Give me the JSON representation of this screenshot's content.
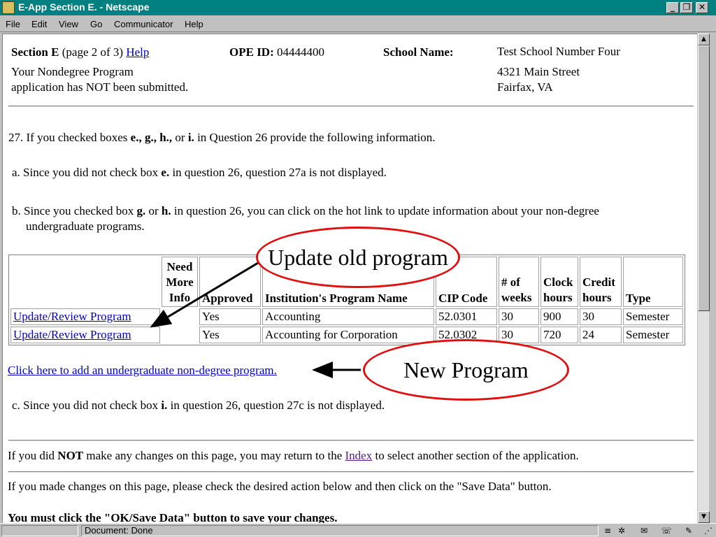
{
  "window": {
    "title": "E-App Section E. - Netscape"
  },
  "menu": [
    "File",
    "Edit",
    "View",
    "Go",
    "Communicator",
    "Help"
  ],
  "header": {
    "section_label": "Section E",
    "page_info": "(page 2 of 3)",
    "help_link": "Help",
    "ope_label": "OPE ID:",
    "ope_value": "04444400",
    "school_label": "School Name:",
    "school_name": "Test School Number Four",
    "address_line1": "4321 Main Street",
    "address_line2": "Fairfax, VA",
    "status_line1": "Your Nondegree Program",
    "status_line2": "application has NOT been submitted."
  },
  "q27": {
    "intro_pre": "27. If you checked boxes ",
    "intro_bold": "e., g., h.,",
    "intro_mid": " or ",
    "intro_bold2": "i.",
    "intro_post": " in Question 26 provide the following information.",
    "a_pre": "a. Since you did not check box ",
    "a_bold": "e.",
    "a_post": " in question 26, question 27a is not displayed.",
    "b_pre": "b. Since you checked box ",
    "b_bold1": "g.",
    "b_mid": " or ",
    "b_bold2": "h.",
    "b_post": " in question 26, you can click on the hot link to update information about your non-degree",
    "b_line2": "undergraduate programs.",
    "add_link": "Click here to add an undergraduate non-degree program.",
    "c_pre": "c. Since you did not check box ",
    "c_bold": "i.",
    "c_post": " in question 26, question 27c is not displayed."
  },
  "table": {
    "headers": {
      "need_more_info": "Need More Info",
      "approved": "Approved",
      "program_name": "Institution's Program Name",
      "cip_code": "CIP Code",
      "weeks": "# of weeks",
      "clock_hours": "Clock hours",
      "credit_hours": "Credit hours",
      "type": "Type"
    },
    "rows": [
      {
        "link": "Update/Review Program",
        "need_more_info": "",
        "approved": "Yes",
        "program_name": "Accounting",
        "cip_code": "52.0301",
        "weeks": "30",
        "clock_hours": "900",
        "credit_hours": "30",
        "type": "Semester"
      },
      {
        "link": "Update/Review Program",
        "need_more_info": "",
        "approved": "Yes",
        "program_name": "Accounting for Corporation",
        "cip_code": "52.0302",
        "weeks": "30",
        "clock_hours": "720",
        "credit_hours": "24",
        "type": "Semester"
      }
    ]
  },
  "annotations": {
    "update_callout": "Update old program",
    "new_callout": "New Program"
  },
  "footer": {
    "notice_pre": "If you did ",
    "notice_bold": "NOT",
    "notice_mid": " make any changes on this page, you may return to the ",
    "index_link": "Index",
    "notice_post": " to select another section of the application.",
    "changes_text": "If you made changes on this page, please check the desired action below and then click on the \"Save Data\" button.",
    "must_text": "You must click the \"OK/Save Data\" button to save your changes."
  },
  "status": {
    "text": "Document: Done"
  },
  "colors": {
    "titlebar": "#008080",
    "link": "#0000cc",
    "visited_link": "#551a8b",
    "callout_border": "#e01010"
  }
}
